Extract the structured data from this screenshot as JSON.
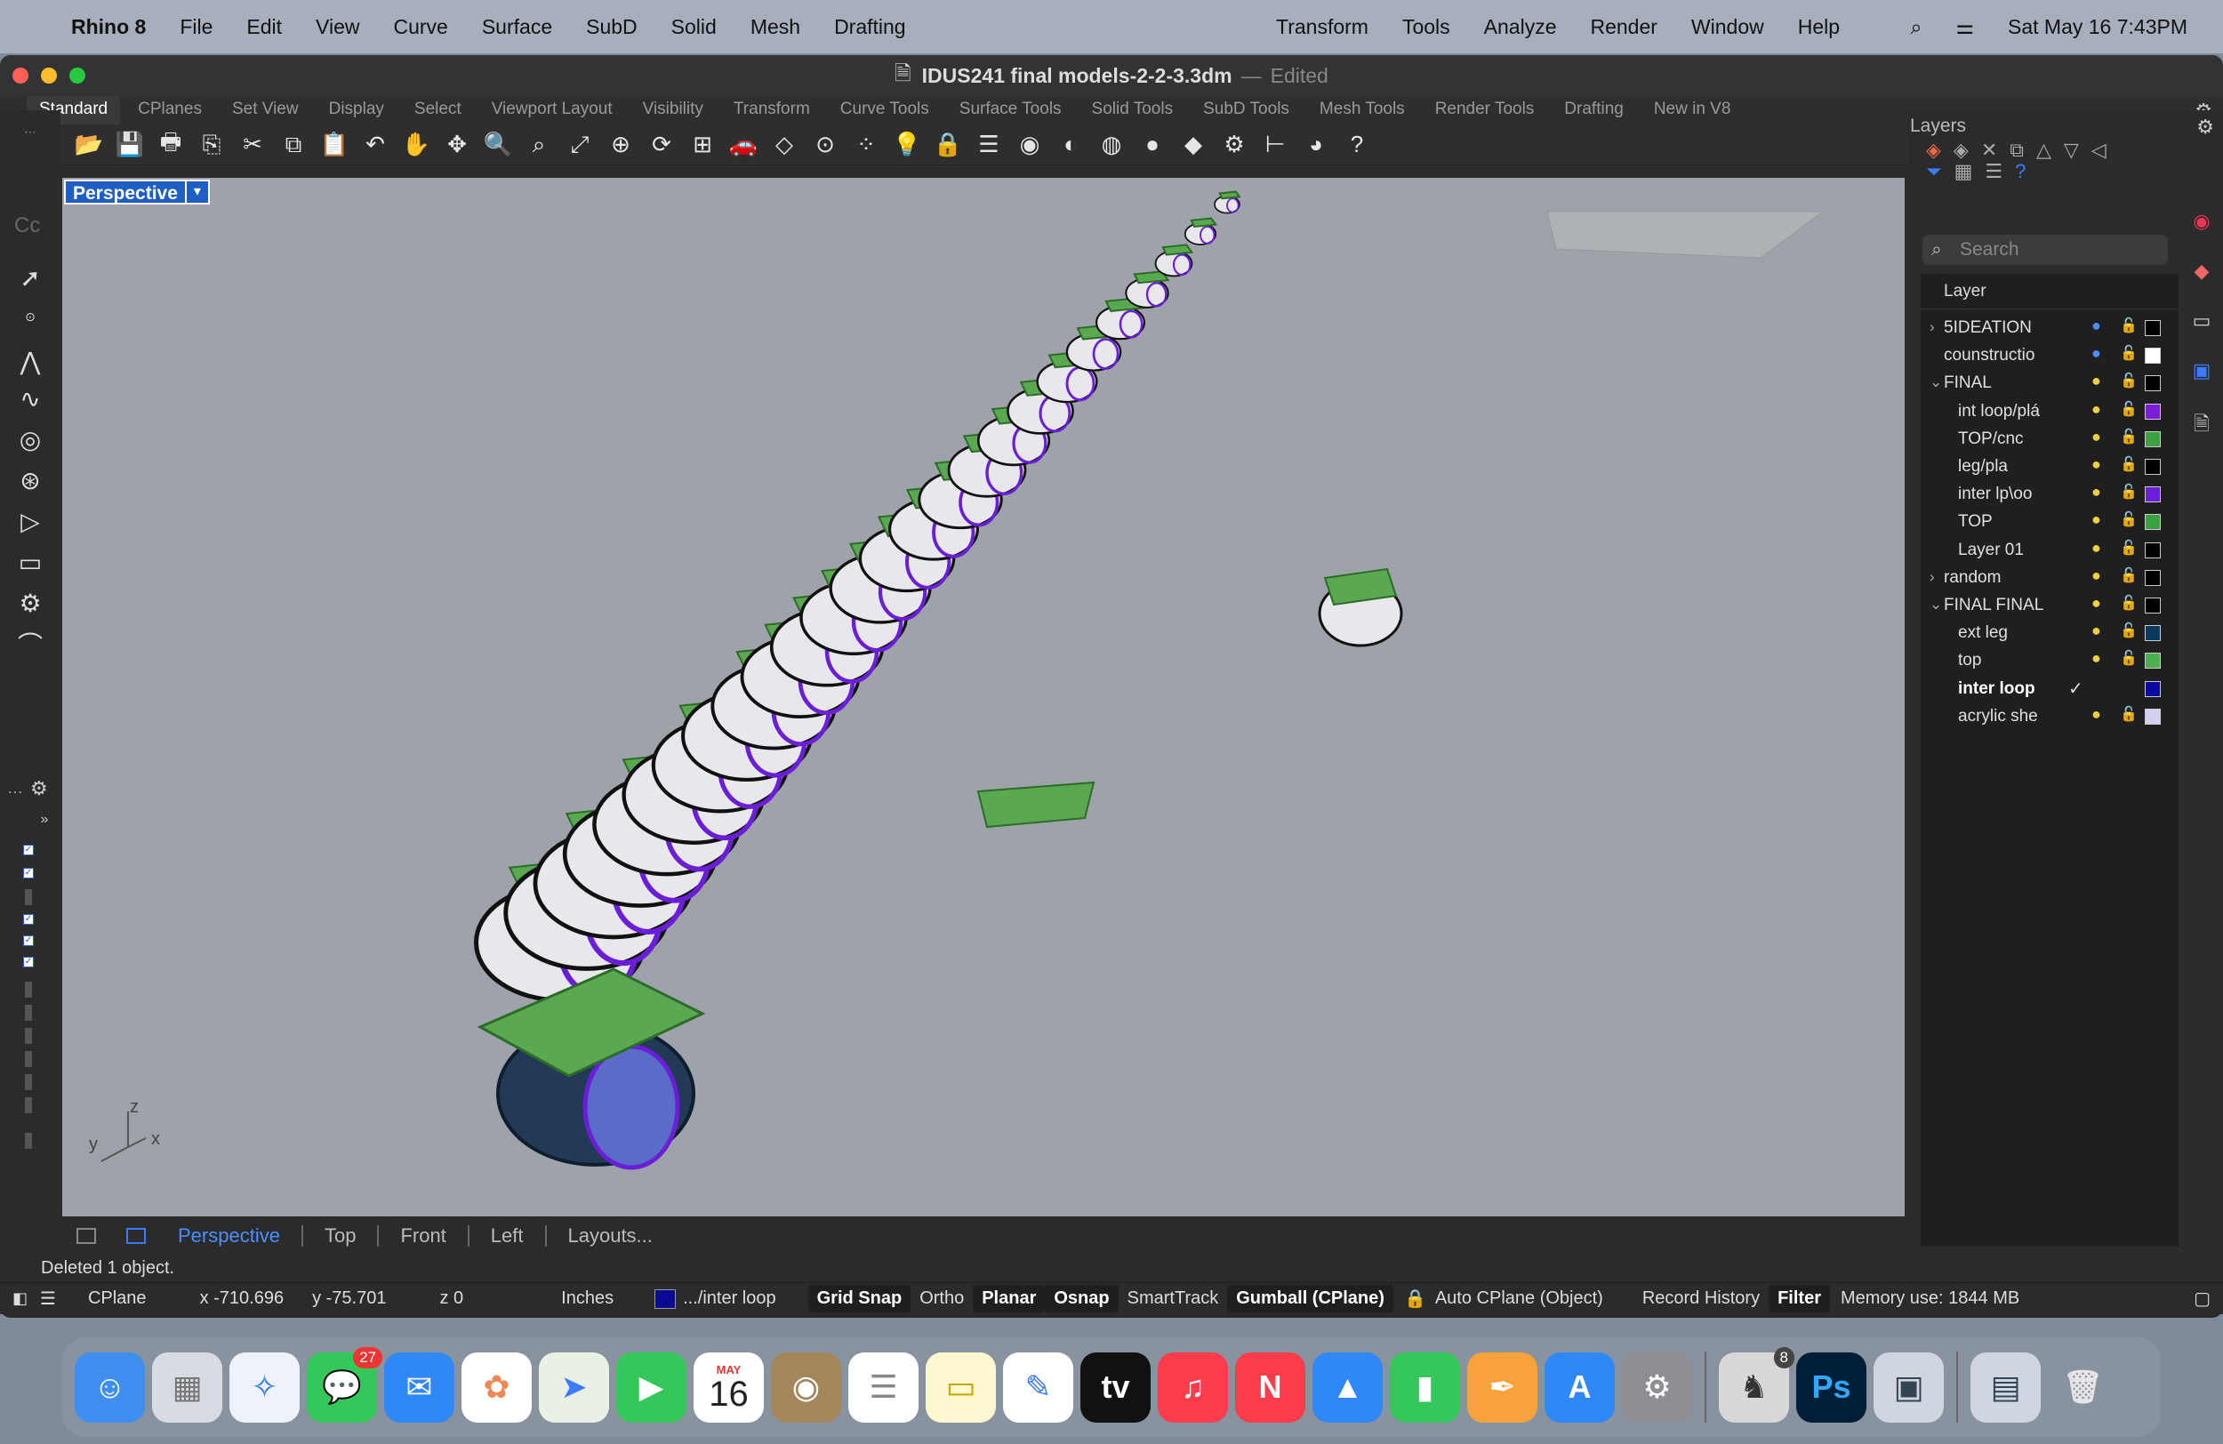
{
  "menubar": {
    "app_name": "Rhino 8",
    "menus": [
      "File",
      "Edit",
      "View",
      "Curve",
      "Surface",
      "SubD",
      "Solid",
      "Mesh",
      "Drafting"
    ],
    "menus_right": [
      "Transform",
      "Tools",
      "Analyze",
      "Render",
      "Window",
      "Help"
    ],
    "datetime": "Sat May 16  7:43PM"
  },
  "window": {
    "title": "IDUS241 final models-2-2-3.3dm",
    "title_sep": "—",
    "title_status": "Edited"
  },
  "toolbar_tabs": [
    "Standard",
    "CPlanes",
    "Set View",
    "Display",
    "Select",
    "Viewport Layout",
    "Visibility",
    "Transform",
    "Curve Tools",
    "Surface Tools",
    "Solid Tools",
    "SubD Tools",
    "Mesh Tools",
    "Render Tools",
    "Drafting",
    "New in V8"
  ],
  "toolbar_icons": [
    "new-icon",
    "open-icon",
    "save-icon",
    "print-icon",
    "import-icon",
    "cut-icon",
    "copy-icon",
    "paste-icon",
    "undo-icon",
    "pan-icon",
    "rotate-view-icon",
    "zoom-icon",
    "zoom-window-icon",
    "zoom-extents-icon",
    "zoom-selected-icon",
    "rotate-icon",
    "viewport-layout-icon",
    "car-icon",
    "cplane-icon",
    "osnap-icon",
    "points-icon",
    "light-icon",
    "lock-icon",
    "layer-icon",
    "color-wheel-icon",
    "shaded-icon",
    "rendered-icon",
    "sphere-icon",
    "material-icon",
    "settings-icon",
    "dimension-icon",
    "render-icon",
    "help-icon"
  ],
  "left_palette": {
    "command_hint": "Cc"
  },
  "viewport": {
    "name": "Perspective",
    "axis": {
      "z": "z",
      "y": "y",
      "x": "x"
    }
  },
  "viewport_tabs": {
    "active": "Perspective",
    "tabs": [
      "Top",
      "Front",
      "Left",
      "Layouts..."
    ]
  },
  "layers_panel": {
    "title": "Layers",
    "search_placeholder": "Search",
    "column_header": "Layer",
    "rows": [
      {
        "name": "5IDEATION",
        "level": 0,
        "expander": "›",
        "color": "#000000"
      },
      {
        "name": "counstructio",
        "level": 0,
        "expander": "",
        "color": "#ffffff"
      },
      {
        "name": "FINAL",
        "level": 0,
        "expander": "⌄",
        "color": "#000000"
      },
      {
        "name": "int loop/plá",
        "level": 1,
        "expander": "",
        "color": "#7a1fd6"
      },
      {
        "name": "TOP/cnc",
        "level": 1,
        "expander": "",
        "color": "#3aa040"
      },
      {
        "name": "leg/pla",
        "level": 1,
        "expander": "",
        "color": "#000000"
      },
      {
        "name": "inter lp\\oo",
        "level": 1,
        "expander": "",
        "color": "#6a1fd6"
      },
      {
        "name": "TOP",
        "level": 1,
        "expander": "",
        "color": "#3aa040"
      },
      {
        "name": "Layer 01",
        "level": 1,
        "expander": "",
        "color": "#000000"
      },
      {
        "name": "random",
        "level": 0,
        "expander": "›",
        "color": "#000000"
      },
      {
        "name": "FINAL FINAL",
        "level": 0,
        "expander": "⌄",
        "color": "#000000"
      },
      {
        "name": "ext leg",
        "level": 1,
        "expander": "",
        "color": "#0c3a5a"
      },
      {
        "name": "top",
        "level": 1,
        "expander": "",
        "color": "#4caf50"
      },
      {
        "name": "inter loop",
        "level": 1,
        "expander": "",
        "color": "#0a0aa0",
        "current": true
      },
      {
        "name": "acrylic she",
        "level": 1,
        "expander": "",
        "color": "#d0d0f0"
      }
    ]
  },
  "command_line": {
    "message": "Deleted 1 object."
  },
  "statusbar": {
    "cplane": "CPlane",
    "x": "x -710.696",
    "y": "y -75.701",
    "z": "z 0",
    "units": "Inches",
    "layer": ".../inter loop",
    "grid_snap": "Grid Snap",
    "ortho": "Ortho",
    "planar": "Planar",
    "osnap": "Osnap",
    "smarttrack": "SmartTrack",
    "gumball": "Gumball (CPlane)",
    "auto_cplane": "Auto CPlane (Object)",
    "record_history": "Record History",
    "filter": "Filter",
    "memory": "Memory use: 1844 MB"
  },
  "dock": {
    "messages_badge": "27",
    "calendar_month": "MAY",
    "calendar_day": "16",
    "appletv_label": "tv",
    "ps_label": "Ps",
    "rhino_badge": "8"
  },
  "colors": {
    "accent": "#1e5fc4",
    "viewport_bg": "#9ea2a9",
    "green_top": "#5aa84f",
    "purple_loop": "#6a1fd6"
  }
}
